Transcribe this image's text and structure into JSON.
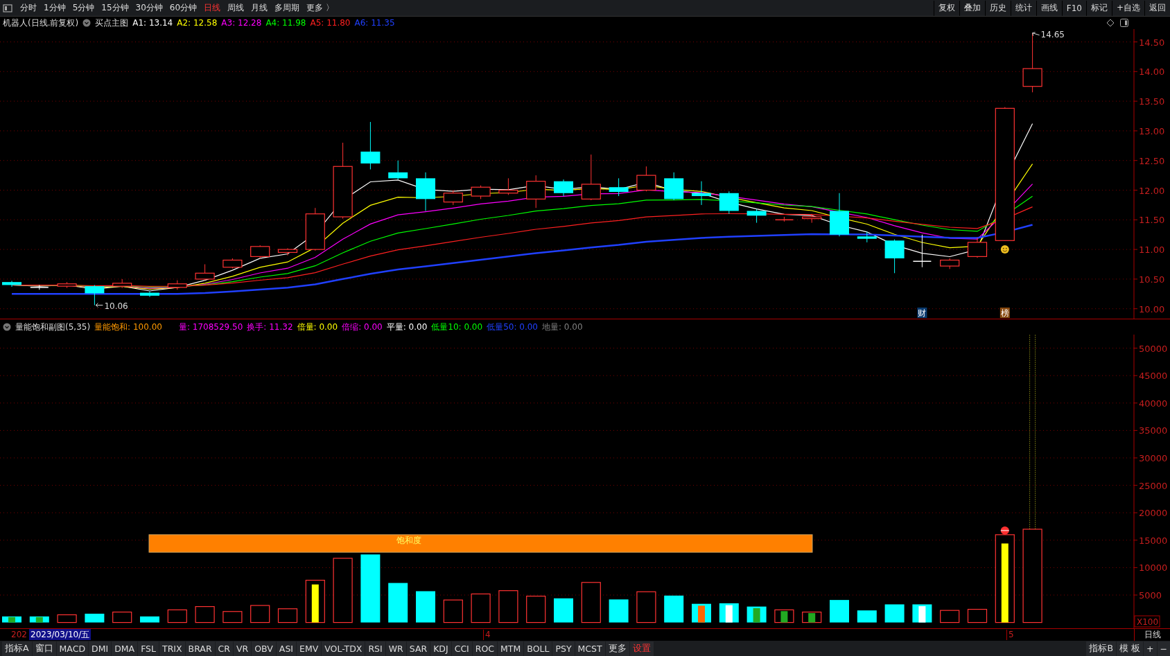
{
  "top_toolbar": {
    "periods": [
      {
        "label": "分时",
        "selected": false
      },
      {
        "label": "1分钟",
        "selected": false
      },
      {
        "label": "5分钟",
        "selected": false
      },
      {
        "label": "15分钟",
        "selected": false
      },
      {
        "label": "30分钟",
        "selected": false
      },
      {
        "label": "60分钟",
        "selected": false
      },
      {
        "label": "日线",
        "selected": true
      },
      {
        "label": "周线",
        "selected": false
      },
      {
        "label": "月线",
        "selected": false
      },
      {
        "label": "多周期",
        "selected": false
      },
      {
        "label": "更多 〉",
        "selected": false
      }
    ],
    "tools": [
      "复权",
      "叠加",
      "历史",
      "统计",
      "画线",
      "F10",
      "标记",
      "+自选",
      "返回"
    ]
  },
  "main_chart": {
    "title": "机器人(日线.前复权)",
    "indicator": "买点主图",
    "values": [
      {
        "text": "A1: 13.14",
        "color": "#ffffff"
      },
      {
        "text": "A2: 12.58",
        "color": "#ffff00"
      },
      {
        "text": "A3: 12.28",
        "color": "#ff00ff"
      },
      {
        "text": "A4: 11.98",
        "color": "#00ff00"
      },
      {
        "text": "A5: 11.80",
        "color": "#ff2020"
      },
      {
        "text": "A6: 11.35",
        "color": "#2040ff"
      }
    ],
    "high_label": "14.65",
    "low_label": "10.06",
    "markers": [
      "财",
      "榜"
    ],
    "y_axis": [
      "14.50",
      "14.00",
      "13.50",
      "13.00",
      "12.50",
      "12.00",
      "11.50",
      "11.00",
      "10.50",
      "10.00"
    ]
  },
  "sub_chart": {
    "indicator": "量能饱和副图(5,35)",
    "values": [
      {
        "text": "量能饱和: 100.00",
        "color": "#ff9900"
      },
      {
        "text": "量: 1708529.50",
        "color": "#ff00ff"
      },
      {
        "text": "换手: 11.32",
        "color": "#ff00ff"
      },
      {
        "text": "倍量: 0.00",
        "color": "#ffff00"
      },
      {
        "text": "倍缩: 0.00",
        "color": "#ff00ff"
      },
      {
        "text": "平量: 0.00",
        "color": "#ffffff"
      },
      {
        "text": "低量10: 0.00",
        "color": "#00ff00"
      },
      {
        "text": "低量50: 0.00",
        "color": "#2040ff"
      },
      {
        "text": "地量: 0.00",
        "color": "#808080"
      }
    ],
    "band_label": "饱和度",
    "y_axis": [
      "50000",
      "45000",
      "40000",
      "35000",
      "30000",
      "25000",
      "20000",
      "15000",
      "10000",
      "5000"
    ],
    "unit": "X100"
  },
  "date_row": {
    "cut_text": "202",
    "cursor_date": "2023/03/10/五",
    "month_marks": [
      "4",
      "5"
    ],
    "period": "日线"
  },
  "bottom_tabs": [
    "指标A",
    "窗口",
    "MACD",
    "DMI",
    "DMA",
    "FSL",
    "TRIX",
    "BRAR",
    "CR",
    "VR",
    "OBV",
    "ASI",
    "EMV",
    "VOL-TDX",
    "RSI",
    "WR",
    "SAR",
    "KDJ",
    "CCI",
    "ROC",
    "MTM",
    "BOLL",
    "PSY",
    "MCST",
    "更多"
  ],
  "settings_tab": "设置",
  "bottom_right": [
    "指标B",
    "模 板",
    "+",
    "−"
  ]
}
